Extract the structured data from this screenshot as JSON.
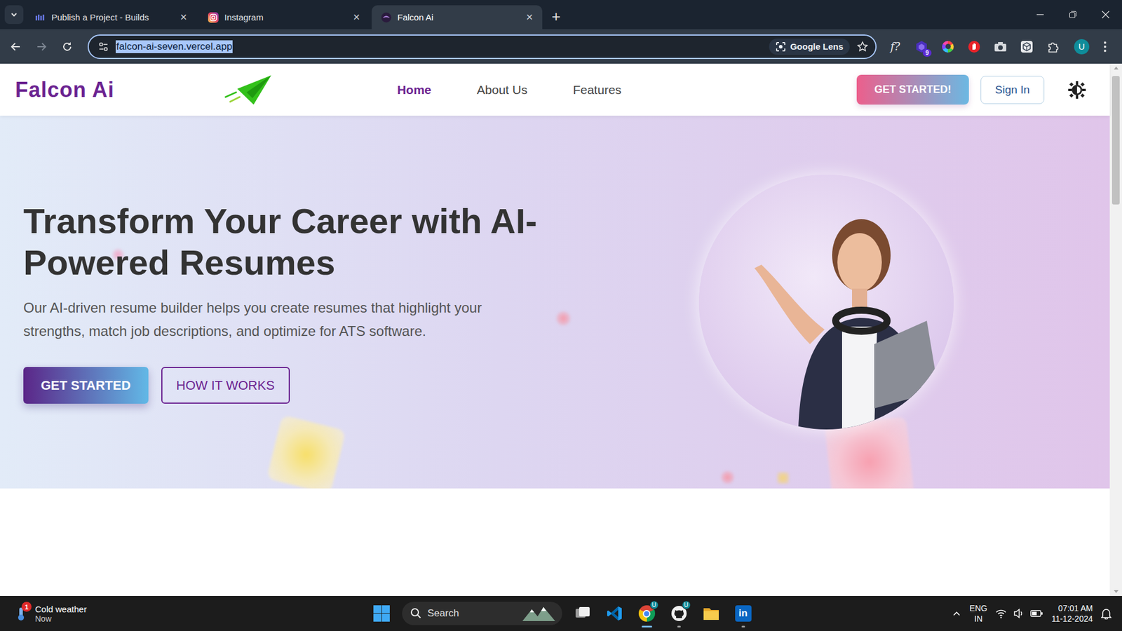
{
  "browser": {
    "tabs": [
      {
        "label": "Publish a Project - Builds",
        "selected": false,
        "kind": "builds",
        "close": "×"
      },
      {
        "label": "Instagram",
        "selected": false,
        "kind": "instagram",
        "close": "×"
      },
      {
        "label": "Falcon Ai",
        "selected": true,
        "kind": "falcon",
        "close": "×"
      }
    ],
    "new_tab": "+",
    "address": {
      "url": "falcon-ai-seven.vercel.app",
      "selected": true
    },
    "lens": "Google Lens",
    "extensions": [
      {
        "kind": "formula",
        "label": "f?"
      },
      {
        "kind": "hex",
        "badge": "9"
      },
      {
        "kind": "colorwheel"
      },
      {
        "kind": "hand"
      },
      {
        "kind": "camera"
      },
      {
        "kind": "cube"
      },
      {
        "kind": "puzzle"
      }
    ],
    "profile": "U"
  },
  "page": {
    "brand": "Falcon Ai",
    "nav": [
      {
        "label": "Home",
        "selected": true
      },
      {
        "label": "About Us",
        "selected": false
      },
      {
        "label": "Features",
        "selected": false
      }
    ],
    "cta": "GET STARTED!",
    "sign_in": "Sign In",
    "hero": {
      "title": "Transform Your Career with AI-Powered Resumes",
      "subtitle": "Our AI-driven resume builder helps you create resumes that highlight your strengths, match job descriptions, and optimize for ATS software.",
      "primary": "GET STARTED",
      "secondary": "HOW IT WORKS"
    },
    "scrollbar": {
      "level": 0.25
    }
  },
  "taskbar": {
    "weather": {
      "title": "Cold weather",
      "time": "Now",
      "badge": "1"
    },
    "search": "Search",
    "apps": [
      {
        "kind": "taskview",
        "running": false,
        "active": false
      },
      {
        "kind": "vscode",
        "running": false,
        "active": false
      },
      {
        "kind": "chrome",
        "running": true,
        "active": true,
        "badge": "U"
      },
      {
        "kind": "github",
        "running": true,
        "active": false,
        "badge": "U"
      },
      {
        "kind": "files",
        "running": false,
        "active": false
      },
      {
        "kind": "linkedin",
        "running": true,
        "active": false,
        "label": "in"
      }
    ],
    "language": [
      "ENG",
      "IN"
    ],
    "clock": {
      "time": "07:01 AM",
      "date": "11-12-2024"
    }
  }
}
